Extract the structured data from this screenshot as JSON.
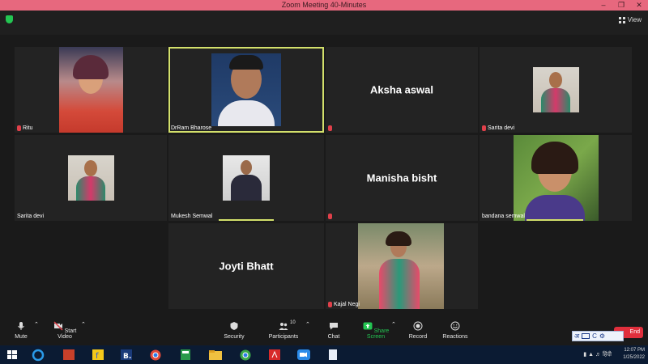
{
  "window": {
    "title": "Zoom Meeting 40-Minutes"
  },
  "top": {
    "view_label": "View"
  },
  "tiles": [
    {
      "name": "Ritu",
      "muted": true
    },
    {
      "name": "DrRam Bharose",
      "muted": false
    },
    {
      "name": "Aksha aswal",
      "muted": true
    },
    {
      "name": "Sarita devi",
      "muted": true
    },
    {
      "name": "Sarita devi",
      "muted": false
    },
    {
      "name": "Mukesh Semwal",
      "muted": false
    },
    {
      "name": "Manisha bisht",
      "muted": true
    },
    {
      "name": "bandana semwal",
      "muted": false
    },
    {
      "name": "Joyti Bhatt",
      "muted": false
    },
    {
      "name": "Kajal Negi",
      "muted": true
    }
  ],
  "toolbar": {
    "mute": "Mute",
    "start_video": "Start Video",
    "security": "Security",
    "participants": "Participants",
    "participants_count": "10",
    "chat": "Chat",
    "share_screen": "Share Screen",
    "record": "Record",
    "reactions": "Reactions",
    "end": "End"
  },
  "ime": {
    "hindi_char": "अ",
    "c": "C"
  },
  "taskbar": {
    "time": "12:07 PM",
    "date": "1/25/2022",
    "lang": "हिंदी"
  },
  "colors": {
    "titlebar": "#e7687e",
    "active_speaker": "#d3e06b",
    "share_green": "#23c552",
    "end_red": "#e02f3c"
  }
}
